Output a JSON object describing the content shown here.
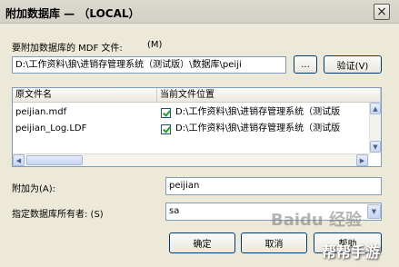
{
  "window": {
    "title": "附加数据库 —   （LOCAL）",
    "close_label": "×"
  },
  "mdf": {
    "label": "要附加数据库的 MDF 文件:",
    "shortcut": "(M)",
    "path_value": "D:\\工作资料\\狼\\进销存管理系统（测试版）\\数据库\\peiji",
    "browse_label": "...",
    "verify_label": "验证(V)"
  },
  "files_table": {
    "columns": [
      "原文件名",
      "当前文件位置"
    ],
    "rows": [
      {
        "name": "peijian.mdf",
        "checked": true,
        "location": "D:\\工作资料\\狼\\进销存管理系统（测试版"
      },
      {
        "name": "peijian_Log.LDF",
        "checked": true,
        "location": "D:\\工作资料\\狼\\进销存管理系统（测试版"
      }
    ],
    "scroll_left": "◀",
    "scroll_right": "▶",
    "scroll_up": "▲",
    "scroll_down": "▼"
  },
  "attach_as": {
    "label": "附加为(A):",
    "value": "peijian"
  },
  "owner": {
    "label": "指定数据库所有者: (S)",
    "value": "sa",
    "dropdown_icon": "▼"
  },
  "buttons": {
    "ok": "确定",
    "cancel": "取消",
    "help": "帮助"
  },
  "watermark": {
    "text": "Baidu 经验",
    "sub": "帮帮手游"
  }
}
